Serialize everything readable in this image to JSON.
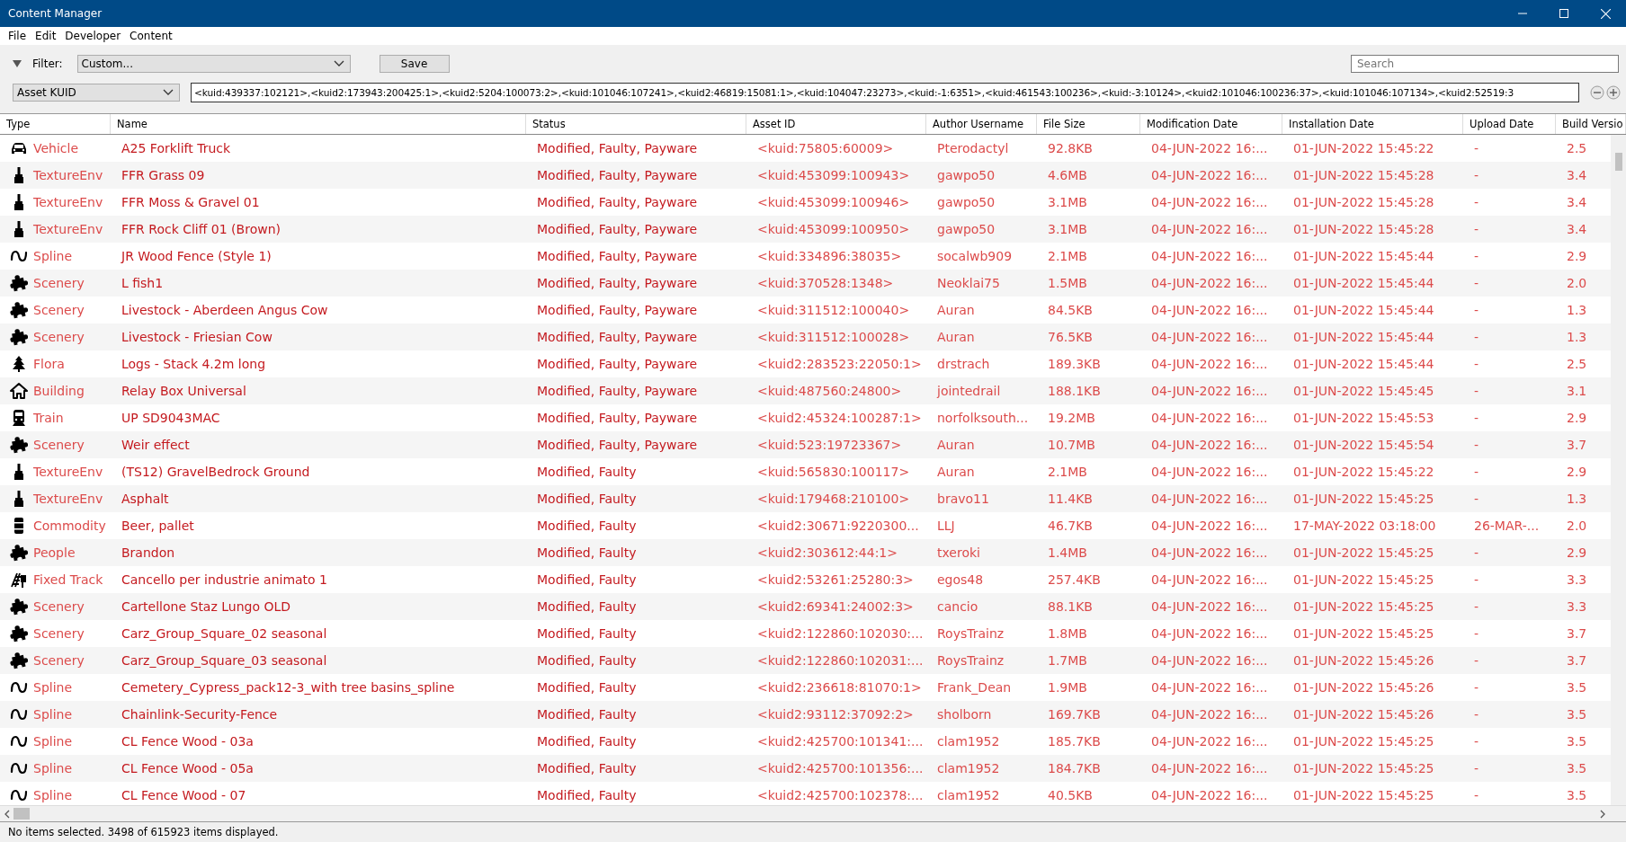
{
  "window": {
    "title": "Content Manager"
  },
  "menu": [
    "File",
    "Edit",
    "Developer",
    "Content"
  ],
  "filter": {
    "label": "Filter:",
    "value": "Custom...",
    "save": "Save",
    "search_placeholder": "Search"
  },
  "kuid_filter": {
    "field": "Asset KUID",
    "value": "<kuid:439337:102121>,<kuid2:173943:200425:1>,<kuid2:5204:100073:2>,<kuid:101046:107241>,<kuid2:46819:15081:1>,<kuid:104047:23273>,<kuid:-1:6351>,<kuid:461543:100236>,<kuid:-3:10124>,<kuid2:101046:100236:37>,<kuid:101046:107134>,<kuid2:52519:3"
  },
  "table": {
    "columns": [
      "Type",
      "Name",
      "Status",
      "Asset ID",
      "Author Username",
      "File Size",
      "Modification Date",
      "Installation Date",
      "Upload Date",
      "Build Versio"
    ],
    "rows": [
      {
        "kind": "car",
        "cells": [
          "Vehicle",
          "A25 Forklift Truck",
          "Modified, Faulty, Payware",
          "<kuid:75805:60009>",
          "Pterodactyl",
          "92.8KB",
          "04-JUN-2022 16:...",
          "01-JUN-2022 15:45:22",
          "-",
          "2.5"
        ]
      },
      {
        "kind": "brush",
        "cells": [
          "TextureEnv",
          "FFR Grass 09",
          "Modified, Faulty, Payware",
          "<kuid:453099:100943>",
          "gawpo50",
          "4.6MB",
          "04-JUN-2022 16:...",
          "01-JUN-2022 15:45:28",
          "-",
          "3.4"
        ]
      },
      {
        "kind": "brush",
        "cells": [
          "TextureEnv",
          "FFR Moss & Gravel 01",
          "Modified, Faulty, Payware",
          "<kuid:453099:100946>",
          "gawpo50",
          "3.1MB",
          "04-JUN-2022 16:...",
          "01-JUN-2022 15:45:28",
          "-",
          "3.4"
        ]
      },
      {
        "kind": "brush",
        "cells": [
          "TextureEnv",
          "FFR Rock Cliff 01 (Brown)",
          "Modified, Faulty, Payware",
          "<kuid:453099:100950>",
          "gawpo50",
          "3.1MB",
          "04-JUN-2022 16:...",
          "01-JUN-2022 15:45:28",
          "-",
          "3.4"
        ]
      },
      {
        "kind": "wave",
        "cells": [
          "Spline",
          "JR Wood Fence (Style 1)",
          "Modified, Faulty, Payware",
          "<kuid:334896:38035>",
          "socalwb909",
          "2.1MB",
          "04-JUN-2022 16:...",
          "01-JUN-2022 15:45:44",
          "-",
          "2.9"
        ]
      },
      {
        "kind": "puzzle",
        "cells": [
          "Scenery",
          "L fish1",
          "Modified, Faulty, Payware",
          "<kuid:370528:1348>",
          "Neoklai75",
          "1.5MB",
          "04-JUN-2022 16:...",
          "01-JUN-2022 15:45:44",
          "-",
          "2.0"
        ]
      },
      {
        "kind": "puzzle",
        "cells": [
          "Scenery",
          "Livestock - Aberdeen Angus Cow",
          "Modified, Faulty, Payware",
          "<kuid:311512:100040>",
          "Auran",
          "84.5KB",
          "04-JUN-2022 16:...",
          "01-JUN-2022 15:45:44",
          "-",
          "1.3"
        ]
      },
      {
        "kind": "puzzle",
        "cells": [
          "Scenery",
          "Livestock - Friesian Cow",
          "Modified, Faulty, Payware",
          "<kuid:311512:100028>",
          "Auran",
          "76.5KB",
          "04-JUN-2022 16:...",
          "01-JUN-2022 15:45:44",
          "-",
          "1.3"
        ]
      },
      {
        "kind": "tree",
        "cells": [
          "Flora",
          "Logs - Stack 4.2m long",
          "Modified, Faulty, Payware",
          "<kuid2:283523:22050:1>",
          "drstrach",
          "189.3KB",
          "04-JUN-2022 16:...",
          "01-JUN-2022 15:45:44",
          "-",
          "2.5"
        ]
      },
      {
        "kind": "house",
        "cells": [
          "Building",
          "Relay Box Universal",
          "Modified, Faulty, Payware",
          "<kuid:487560:24800>",
          "jointedrail",
          "188.1KB",
          "04-JUN-2022 16:...",
          "01-JUN-2022 15:45:45",
          "-",
          "3.1"
        ]
      },
      {
        "kind": "train",
        "cells": [
          "Train",
          "UP SD9043MAC",
          "Modified, Faulty, Payware",
          "<kuid2:45324:100287:1>",
          "norfolksouth...",
          "19.2MB",
          "04-JUN-2022 16:...",
          "01-JUN-2022 15:45:53",
          "-",
          "2.9"
        ]
      },
      {
        "kind": "puzzle",
        "cells": [
          "Scenery",
          "Weir effect",
          "Modified, Faulty, Payware",
          "<kuid:523:19723367>",
          "Auran",
          "10.7MB",
          "04-JUN-2022 16:...",
          "01-JUN-2022 15:45:54",
          "-",
          "3.7"
        ]
      },
      {
        "kind": "brush",
        "cells": [
          "TextureEnv",
          "(TS12) GravelBedrock Ground",
          "Modified, Faulty",
          "<kuid:565830:100117>",
          "Auran",
          "2.1MB",
          "04-JUN-2022 16:...",
          "01-JUN-2022 15:45:22",
          "-",
          "2.9"
        ]
      },
      {
        "kind": "brush",
        "cells": [
          "TextureEnv",
          "Asphalt",
          "Modified, Faulty",
          "<kuid:179468:210100>",
          "bravo11",
          "11.4KB",
          "04-JUN-2022 16:...",
          "01-JUN-2022 15:45:25",
          "-",
          "1.3"
        ]
      },
      {
        "kind": "barrel",
        "cells": [
          "Commodity",
          "Beer, pallet",
          "Modified, Faulty",
          "<kuid2:30671:9220300...",
          "LLJ",
          "46.7KB",
          "04-JUN-2022 16:...",
          "17-MAY-2022 03:18:00",
          "26-MAR-...",
          "2.0"
        ]
      },
      {
        "kind": "puzzle",
        "cells": [
          "People",
          "Brandon",
          "Modified, Faulty",
          "<kuid2:303612:44:1>",
          "txeroki",
          "1.4MB",
          "04-JUN-2022 16:...",
          "01-JUN-2022 15:45:25",
          "-",
          "2.9"
        ]
      },
      {
        "kind": "track",
        "cells": [
          "Fixed Track",
          "Cancello per industrie animato 1",
          "Modified, Faulty",
          "<kuid2:53261:25280:3>",
          "egos48",
          "257.4KB",
          "04-JUN-2022 16:...",
          "01-JUN-2022 15:45:25",
          "-",
          "3.3"
        ]
      },
      {
        "kind": "puzzle",
        "cells": [
          "Scenery",
          "Cartellone Staz Lungo OLD",
          "Modified, Faulty",
          "<kuid2:69341:24002:3>",
          "cancio",
          "88.1KB",
          "04-JUN-2022 16:...",
          "01-JUN-2022 15:45:25",
          "-",
          "3.3"
        ]
      },
      {
        "kind": "puzzle",
        "cells": [
          "Scenery",
          "Carz_Group_Square_02 seasonal",
          "Modified, Faulty",
          "<kuid2:122860:102030:...",
          "RoysTrainz",
          "1.8MB",
          "04-JUN-2022 16:...",
          "01-JUN-2022 15:45:25",
          "-",
          "3.7"
        ]
      },
      {
        "kind": "puzzle",
        "cells": [
          "Scenery",
          "Carz_Group_Square_03 seasonal",
          "Modified, Faulty",
          "<kuid2:122860:102031:...",
          "RoysTrainz",
          "1.7MB",
          "04-JUN-2022 16:...",
          "01-JUN-2022 15:45:26",
          "-",
          "3.7"
        ]
      },
      {
        "kind": "wave",
        "cells": [
          "Spline",
          "Cemetery_Cypress_pack12-3_with tree basins_spline",
          "Modified, Faulty",
          "<kuid2:236618:81070:1>",
          "Frank_Dean",
          "1.9MB",
          "04-JUN-2022 16:...",
          "01-JUN-2022 15:45:26",
          "-",
          "3.5"
        ]
      },
      {
        "kind": "wave",
        "cells": [
          "Spline",
          "Chainlink-Security-Fence",
          "Modified, Faulty",
          "<kuid2:93112:37092:2>",
          "sholborn",
          "169.7KB",
          "04-JUN-2022 16:...",
          "01-JUN-2022 15:45:26",
          "-",
          "3.5"
        ]
      },
      {
        "kind": "wave",
        "cells": [
          "Spline",
          "CL Fence Wood - 03a",
          "Modified, Faulty",
          "<kuid2:425700:101341:...",
          "clam1952",
          "185.7KB",
          "04-JUN-2022 16:...",
          "01-JUN-2022 15:45:25",
          "-",
          "3.5"
        ]
      },
      {
        "kind": "wave",
        "cells": [
          "Spline",
          "CL Fence Wood - 05a",
          "Modified, Faulty",
          "<kuid2:425700:101356:...",
          "clam1952",
          "184.7KB",
          "04-JUN-2022 16:...",
          "01-JUN-2022 15:45:25",
          "-",
          "3.5"
        ]
      },
      {
        "kind": "wave",
        "cells": [
          "Spline",
          "CL Fence Wood - 07",
          "Modified, Faulty",
          "<kuid2:425700:102378:...",
          "clam1952",
          "40.5KB",
          "04-JUN-2022 16:...",
          "01-JUN-2022 15:45:25",
          "-",
          "3.5"
        ]
      }
    ]
  },
  "status_bar": "No items selected. 3498 of 615923 items displayed."
}
